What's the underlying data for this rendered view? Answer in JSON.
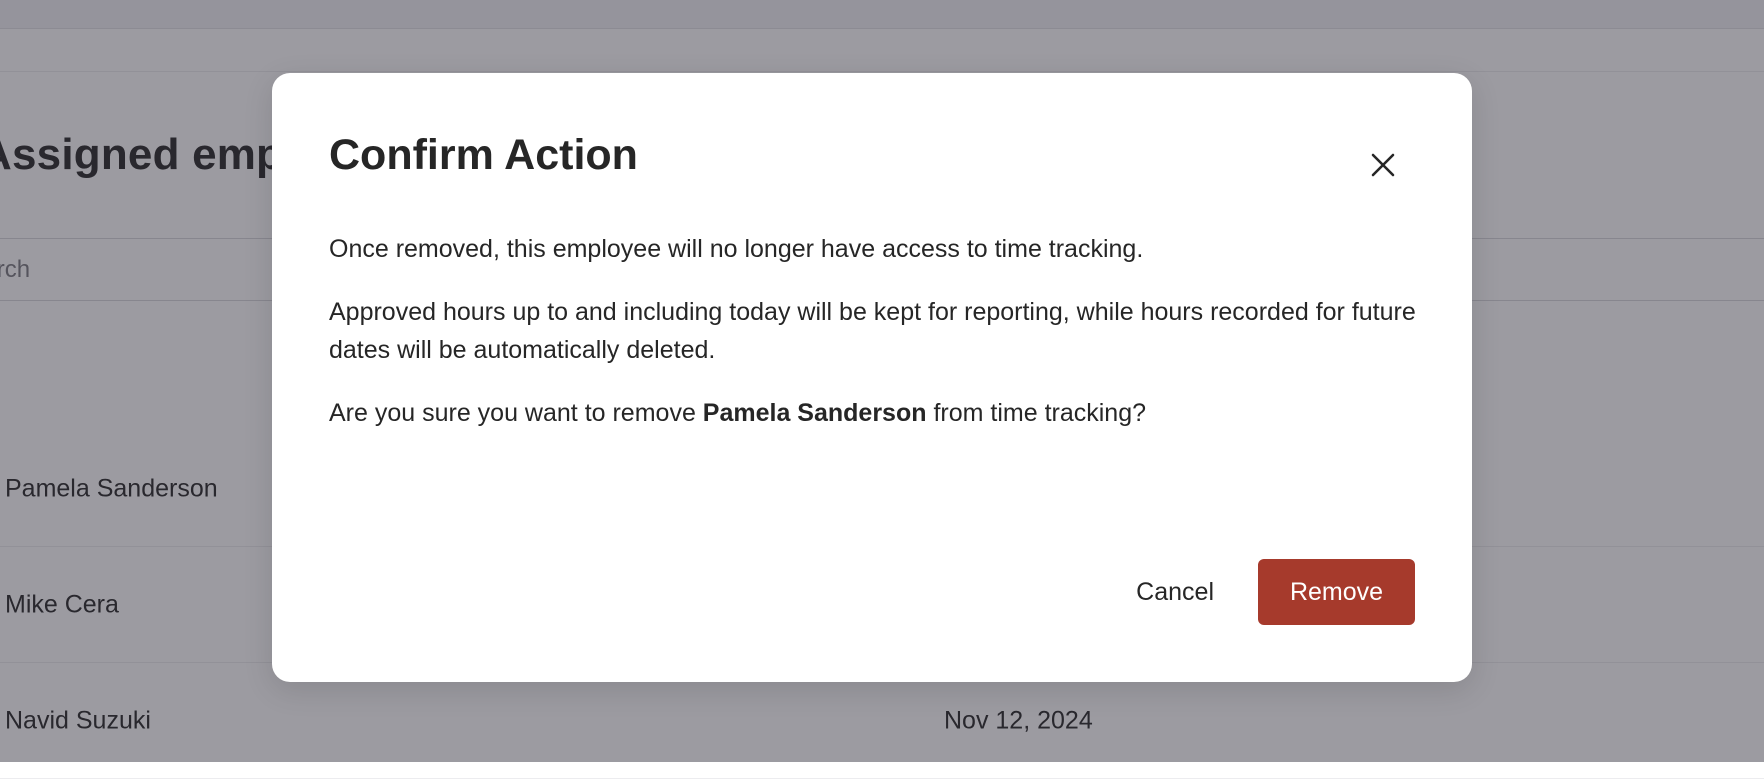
{
  "background": {
    "section_title": "Assigned employees",
    "search": {
      "placeholder": "Search",
      "value": ""
    },
    "employees": [
      {
        "name": "Pamela Sanderson",
        "date": ""
      },
      {
        "name": "Mike Cera",
        "date": ""
      },
      {
        "name": "Navid Suzuki",
        "date": "Nov 12, 2024"
      }
    ]
  },
  "dialog": {
    "title": "Confirm Action",
    "close_icon": "close-icon",
    "paragraph_1": "Once removed, this employee will no longer have access to time tracking.",
    "paragraph_2": "Approved hours up to and including today will be kept for reporting, while hours recorded for future dates will be automatically deleted.",
    "confirm_prefix": "Are you sure you want to remove ",
    "employee_name": "Pamela Sanderson",
    "confirm_suffix": " from time tracking?",
    "cancel_label": "Cancel",
    "remove_label": "Remove"
  },
  "colors": {
    "danger": "#a63a2c",
    "overlay": "#6f6d7a",
    "text": "#262626"
  }
}
